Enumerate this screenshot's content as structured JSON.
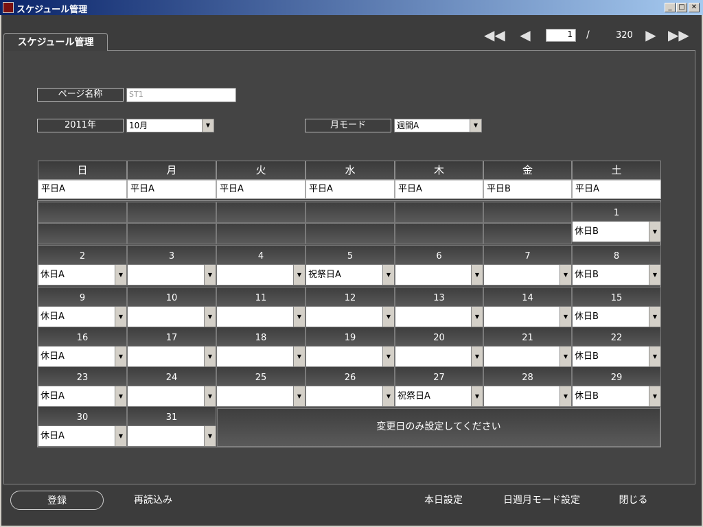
{
  "window": {
    "title": "スケジュール管理"
  },
  "tab": {
    "label": "スケジュール管理"
  },
  "pager": {
    "current": "1",
    "separator": "/",
    "total": "320"
  },
  "form": {
    "page_name_label": "ページ名称",
    "page_name_value": "ST1",
    "year_label": "2011年",
    "month_value": "10月",
    "mode_label": "月モード",
    "mode_value": "週間A"
  },
  "weekdays": [
    "日",
    "月",
    "火",
    "水",
    "木",
    "金",
    "土"
  ],
  "weekday_defaults": [
    "平日A",
    "平日A",
    "平日A",
    "平日A",
    "平日A",
    "平日B",
    "平日A"
  ],
  "calendar": [
    [
      {
        "day": "",
        "value": null
      },
      {
        "day": "",
        "value": null
      },
      {
        "day": "",
        "value": null
      },
      {
        "day": "",
        "value": null
      },
      {
        "day": "",
        "value": null
      },
      {
        "day": "",
        "value": null
      },
      {
        "day": "1",
        "value": "休日B"
      }
    ],
    [
      {
        "day": "2",
        "value": "休日A"
      },
      {
        "day": "3",
        "value": ""
      },
      {
        "day": "4",
        "value": ""
      },
      {
        "day": "5",
        "value": "祝祭日A"
      },
      {
        "day": "6",
        "value": ""
      },
      {
        "day": "7",
        "value": ""
      },
      {
        "day": "8",
        "value": "休日B"
      }
    ],
    [
      {
        "day": "9",
        "value": "休日A"
      },
      {
        "day": "10",
        "value": ""
      },
      {
        "day": "11",
        "value": ""
      },
      {
        "day": "12",
        "value": ""
      },
      {
        "day": "13",
        "value": ""
      },
      {
        "day": "14",
        "value": ""
      },
      {
        "day": "15",
        "value": "休日B"
      }
    ],
    [
      {
        "day": "16",
        "value": "休日A"
      },
      {
        "day": "17",
        "value": ""
      },
      {
        "day": "18",
        "value": ""
      },
      {
        "day": "19",
        "value": ""
      },
      {
        "day": "20",
        "value": ""
      },
      {
        "day": "21",
        "value": ""
      },
      {
        "day": "22",
        "value": "休日B"
      }
    ],
    [
      {
        "day": "23",
        "value": "休日A"
      },
      {
        "day": "24",
        "value": ""
      },
      {
        "day": "25",
        "value": ""
      },
      {
        "day": "26",
        "value": ""
      },
      {
        "day": "27",
        "value": "祝祭日A"
      },
      {
        "day": "28",
        "value": ""
      },
      {
        "day": "29",
        "value": "休日B"
      }
    ],
    [
      {
        "day": "30",
        "value": "休日A"
      },
      {
        "day": "31",
        "value": ""
      }
    ]
  ],
  "notice": "変更日のみ設定してください",
  "footer": {
    "register": "登録",
    "reload": "再読込み",
    "today_setting": "本日設定",
    "mode_setting": "日週月モード設定",
    "close": "閉じる"
  }
}
